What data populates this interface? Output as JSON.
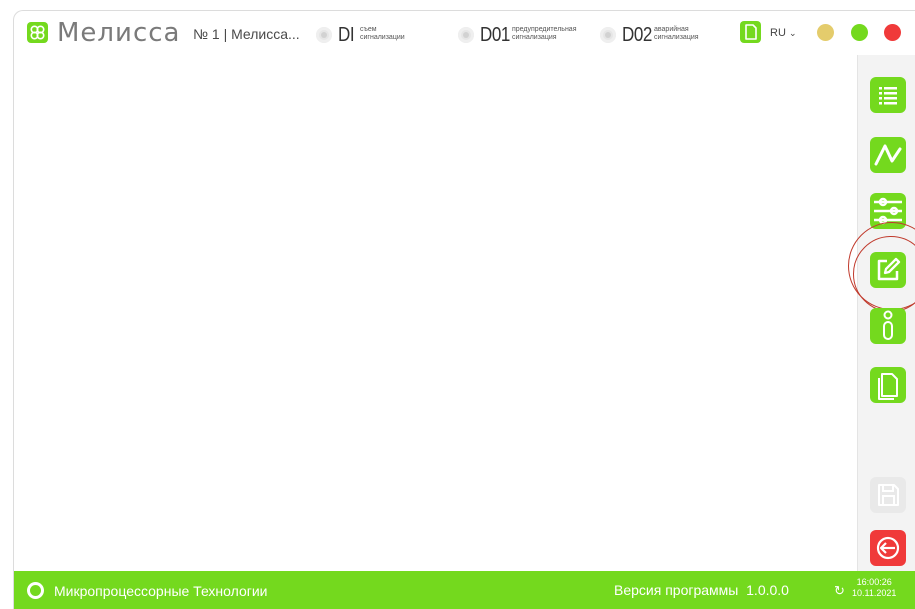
{
  "header": {
    "brand": "Мелисса",
    "device": "№ 1 | Мелисса...",
    "indicators": [
      {
        "code": "DI",
        "sub1": "съем",
        "sub2": "сигнализации"
      },
      {
        "code": "D01",
        "sub1": "предупредительная",
        "sub2": "сигнализация"
      },
      {
        "code": "D02",
        "sub1": "аварийная",
        "sub2": "сигнализация"
      }
    ],
    "language": "RU",
    "window_buttons": [
      "minimize-icon",
      "maximize-icon",
      "close-icon"
    ]
  },
  "sidebar": {
    "buttons": [
      {
        "name": "list-icon"
      },
      {
        "name": "chart-line-icon"
      },
      {
        "name": "sliders-icon"
      },
      {
        "name": "edit-icon"
      },
      {
        "name": "sensor-icon"
      },
      {
        "name": "documents-icon"
      },
      {
        "name": "save-icon"
      },
      {
        "name": "exit-icon"
      }
    ]
  },
  "footer": {
    "company": "Микропроцессорные Технологии",
    "version_label": "Версия программы",
    "version": "1.0.0.0",
    "time": "16:00:26",
    "date": "10.11.2021"
  },
  "colors": {
    "accent": "#74d91e",
    "exit": "#f03a3a",
    "minimize": "#e4cc6c",
    "maximize": "#74d91e",
    "close": "#f03a3a",
    "highlight": "#c0392b"
  }
}
